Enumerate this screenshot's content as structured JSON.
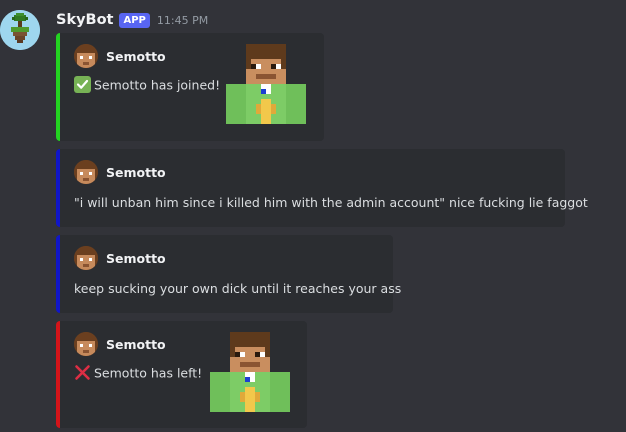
{
  "message": {
    "username": "SkyBot",
    "badge": "APP",
    "timestamp": "11:45 PM"
  },
  "embeds": [
    {
      "author": "Semotto",
      "description": "Semotto has joined!",
      "icon": "check-mark-icon",
      "accent_color": "#23d321"
    },
    {
      "author": "Semotto",
      "description": "\"i will unban him since i killed him with the admin account\" nice fucking lie faggot",
      "accent_color": "#1016c8"
    },
    {
      "author": "Semotto",
      "description": "keep sucking your own dick until it reaches your ass",
      "accent_color": "#1016c8"
    },
    {
      "author": "Semotto",
      "description": "Semotto has left!",
      "icon": "cross-mark-icon",
      "accent_color": "#d4141a"
    }
  ]
}
